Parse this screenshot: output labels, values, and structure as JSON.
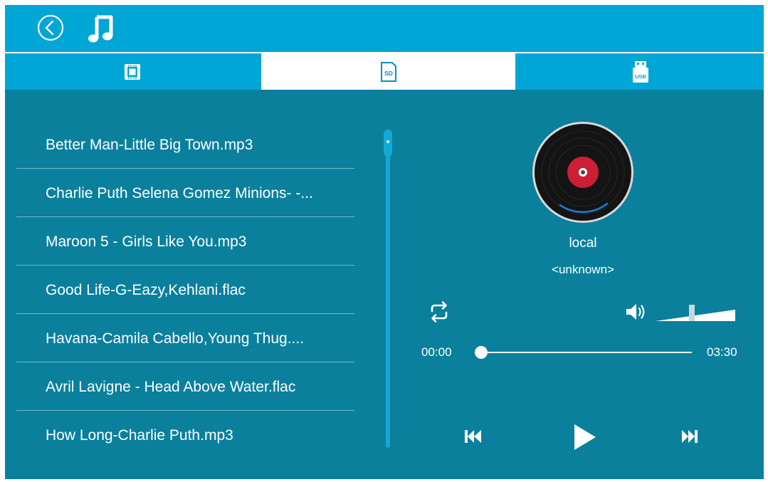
{
  "header": {
    "back_icon": "back-circle-icon",
    "app_icon": "music-note-icon"
  },
  "tabs": [
    {
      "name": "internal-storage",
      "icon": "chip-icon",
      "label": "",
      "selected": false
    },
    {
      "name": "sd-card",
      "icon": "sd-card-icon",
      "label": "SD",
      "selected": true
    },
    {
      "name": "usb",
      "icon": "usb-drive-icon",
      "label": "USB",
      "selected": false
    }
  ],
  "playlist": [
    "Better Man-Little Big Town.mp3",
    "Charlie Puth Selena Gomez Minions- -...",
    "Maroon 5 - Girls Like You.mp3",
    "Good Life-G-Eazy,Kehlani.flac",
    "Havana-Camila Cabello,Young Thug....",
    "Avril Lavigne - Head Above Water.flac",
    "How Long-Charlie Puth.mp3"
  ],
  "player": {
    "artist": "local",
    "album": "<unknown>",
    "current_time": "00:00",
    "total_time": "03:30",
    "progress_fraction": 0.0,
    "volume_fraction": 0.45,
    "disc_icon": "vinyl-record-icon",
    "repeat_icon": "repeat-icon",
    "volume_icon": "speaker-volume-icon",
    "prev_icon": "skip-previous-icon",
    "play_icon": "play-icon",
    "next_icon": "skip-next-icon"
  },
  "colors": {
    "background": "#0a809d",
    "bar": "#00a6d6",
    "accent": "#13a9d5",
    "selected_tab": "#ffffff",
    "disc_label": "#cc1f36"
  }
}
